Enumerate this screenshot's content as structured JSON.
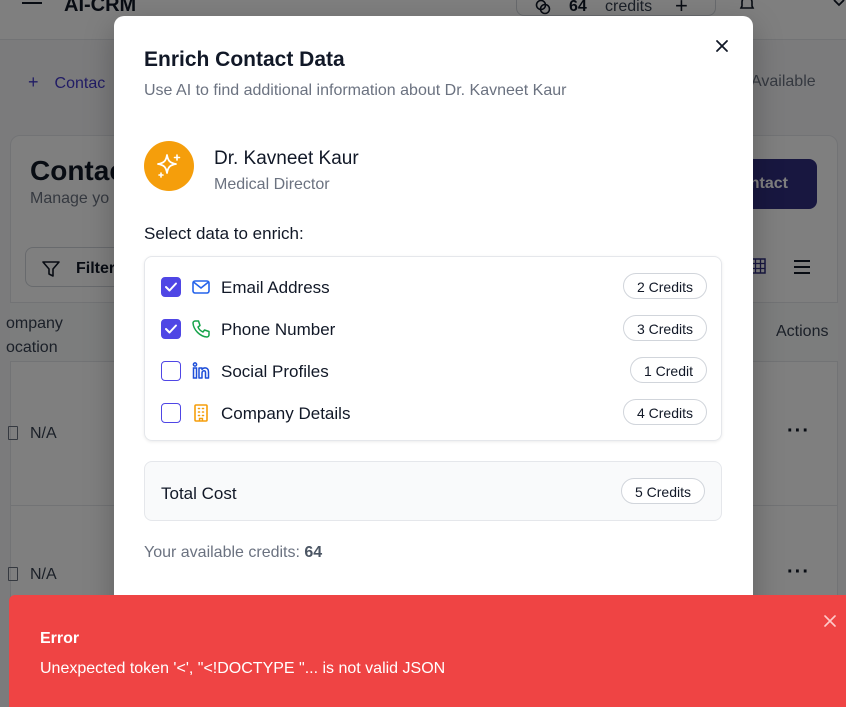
{
  "app": {
    "title": "AI-CRM",
    "credits_count": "64",
    "credits_label": "credits"
  },
  "background": {
    "add_link_label": "Contac",
    "credits_available_partial": "ts Available",
    "page_title": "Contac",
    "page_subtitle": "Manage yo",
    "add_button_label": "ontact",
    "filter_label": "Filter",
    "column_company_line1": "ompany",
    "column_company_line2": "ocation",
    "column_actions": "Actions",
    "rows": [
      {
        "company_location": "N/A"
      },
      {
        "company_location": "N/A"
      }
    ]
  },
  "modal": {
    "title": "Enrich Contact Data",
    "subtitle": "Use AI to find additional information about Dr. Kavneet Kaur",
    "contact": {
      "name": "Dr. Kavneet Kaur",
      "role": "Medical Director",
      "avatar_icon": "sparkles-icon",
      "avatar_color": "#f59e0b"
    },
    "section_label": "Select data to enrich:",
    "options": [
      {
        "label": "Email Address",
        "credits": "2 Credits",
        "checked": true,
        "icon": "mail-icon",
        "icon_color": "#2563eb"
      },
      {
        "label": "Phone Number",
        "credits": "3 Credits",
        "checked": true,
        "icon": "phone-icon",
        "icon_color": "#16a34a"
      },
      {
        "label": "Social Profiles",
        "credits": "1 Credit",
        "checked": false,
        "icon": "linkedin-icon",
        "icon_color": "#1d4ed8"
      },
      {
        "label": "Company Details",
        "credits": "4 Credits",
        "checked": false,
        "icon": "building-icon",
        "icon_color": "#f59e0b"
      }
    ],
    "total_label": "Total Cost",
    "total_value": "5 Credits",
    "available_prefix": "Your available credits:",
    "available_value": "64"
  },
  "toast": {
    "title": "Error",
    "message": "Unexpected token '<', \"<!DOCTYPE \"... is not valid JSON",
    "color": "#ef4444"
  },
  "colors": {
    "accent": "#4f46e5",
    "overlay": "rgba(0,0,0,0.5)"
  }
}
